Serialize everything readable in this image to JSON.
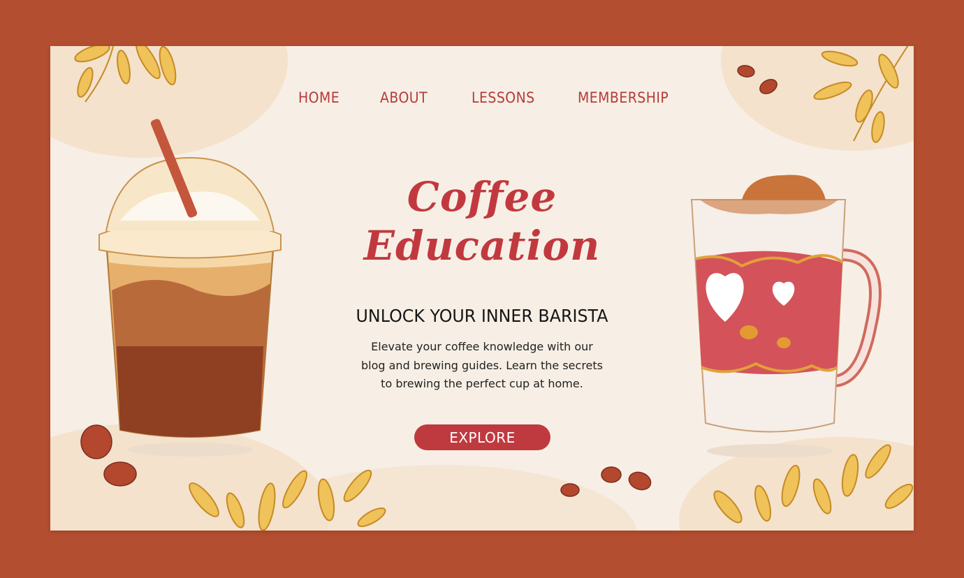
{
  "nav": {
    "home": "HOME",
    "about": "ABOUT",
    "lessons": "LESSONS",
    "membership": "MEMBERSHIP"
  },
  "hero": {
    "title_line1": "Coffee",
    "title_line2": "Education",
    "subtitle": "UNLOCK YOUR INNER BARISTA",
    "description_lines": [
      "Elevate your coffee knowledge with our",
      "blog and brewing guides. Learn the secrets",
      "to brewing the perfect cup at home."
    ],
    "cta": "EXPLORE"
  },
  "icons": [
    "iced-coffee-icon",
    "hot-mug-icon",
    "coffee-bean-icon",
    "leaf-icon"
  ],
  "colors": {
    "frame": "#b44e30",
    "card": "#f7efe5",
    "accent": "#bf3a3f",
    "text": "#161616"
  }
}
